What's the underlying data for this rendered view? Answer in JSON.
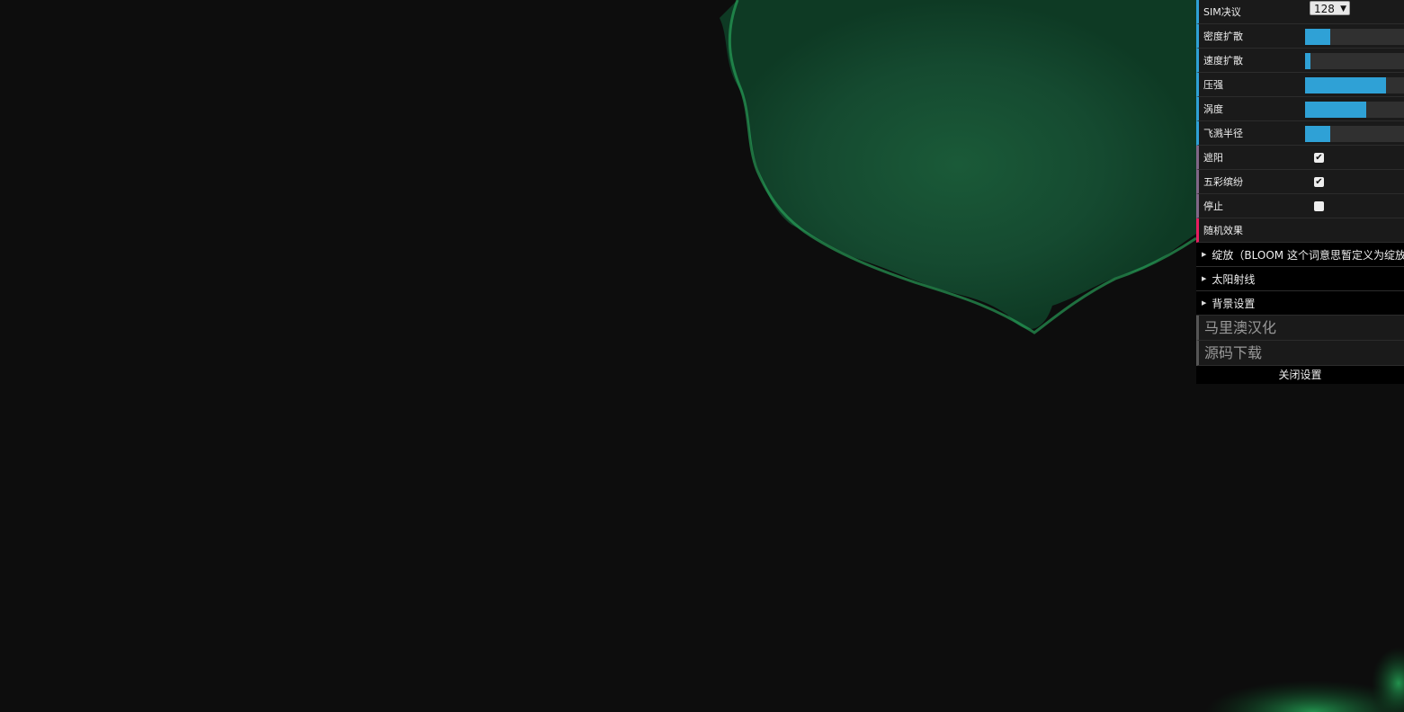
{
  "gui": {
    "sim_resolution": {
      "label": "SIM决议",
      "value": "128"
    },
    "sliders": [
      {
        "name": "density-diffusion",
        "label": "密度扩散",
        "value": 0.25
      },
      {
        "name": "velocity-diffusion",
        "label": "速度扩散",
        "value": 0.05
      },
      {
        "name": "pressure",
        "label": "压强",
        "value": 0.8
      },
      {
        "name": "curl",
        "label": "涡度",
        "value": 0.6
      },
      {
        "name": "splat-radius",
        "label": "飞溅半径",
        "value": 0.25
      }
    ],
    "checkboxes": [
      {
        "name": "shading",
        "label": "遮阳",
        "checked": true
      },
      {
        "name": "colorful",
        "label": "五彩缤纷",
        "checked": true
      },
      {
        "name": "paused",
        "label": "停止",
        "checked": false
      }
    ],
    "random_splats": "随机效果",
    "folders": [
      "绽放（BLOOM 这个词意思暂定义为绽放）",
      "太阳射线",
      "背景设置"
    ],
    "links": [
      "马里澳汉化",
      "源码下载"
    ],
    "close": "关闭设置",
    "accent_color": "#2fa1d6"
  }
}
